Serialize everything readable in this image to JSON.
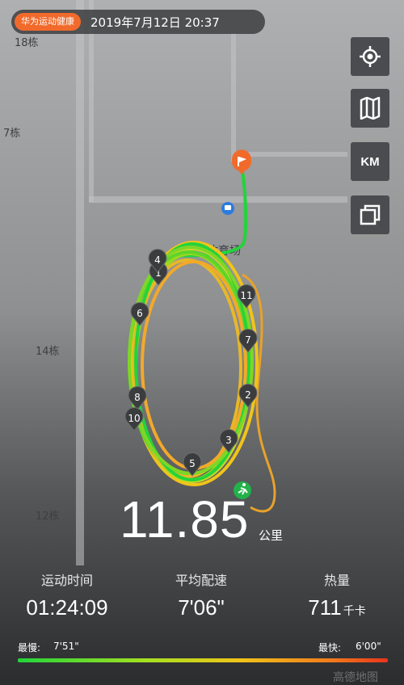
{
  "header": {
    "app_badge": "华为运动健康",
    "datetime": "2019年7月12日 20:37"
  },
  "map": {
    "labels": [
      "18栋",
      "7栋",
      "14栋",
      "12栋",
      "体育场"
    ],
    "pins": [
      "1",
      "2",
      "3",
      "4",
      "5",
      "6",
      "7",
      "8",
      "10",
      "11"
    ],
    "brand": "高德地图",
    "unit_button": "KM",
    "icons": [
      "locate-icon",
      "map-layer-icon",
      "copy-icon",
      "finish-flag-icon",
      "start-runner-icon",
      "stadium-icon"
    ]
  },
  "summary": {
    "distance": "11.85",
    "distance_unit": "公里"
  },
  "stats": {
    "time": {
      "label": "运动时间",
      "value": "01:24:09"
    },
    "pace": {
      "label": "平均配速",
      "value": "7'06\""
    },
    "calories": {
      "label": "热量",
      "value": "711",
      "unit": "千卡"
    }
  },
  "pace_legend": {
    "slow_label": "最慢:",
    "slow_value": "7'51\"",
    "fast_label": "最快:",
    "fast_value": "6'00\""
  },
  "colors": {
    "badge": "#f26a2b",
    "fast": "#22d43a",
    "slow": "#e8341c",
    "flag": "#f26a2b"
  }
}
